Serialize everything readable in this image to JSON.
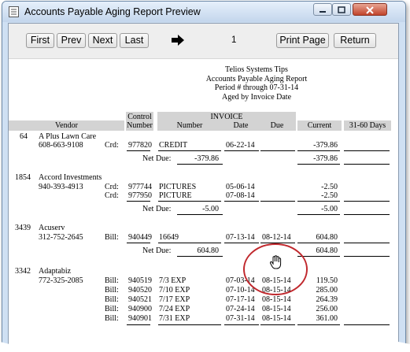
{
  "window": {
    "title": "Accounts Payable Aging Report Preview",
    "accent": "#cfe0f3",
    "close_color": "#c1432b"
  },
  "toolbar": {
    "first": "First",
    "prev": "Prev",
    "next": "Next",
    "last": "Last",
    "page_number": "1",
    "print_page": "Print Page",
    "return": "Return",
    "arrow_icon": "right-arrow-icon"
  },
  "report": {
    "company": "Telios Systems Tips",
    "title": "Accounts Payable Aging Report",
    "period": "Period # through 07-31-14",
    "aged_by": "Aged by Invoice Date",
    "headers": {
      "control_top": "Control",
      "control_bottom": "Number",
      "invoice": "INVOICE",
      "vendor": "Vendor",
      "number": "Number",
      "date": "Date",
      "due": "Due",
      "current": "Current",
      "days_31_60": "31-60 Days"
    },
    "vendors": [
      {
        "id": "64",
        "name": "A Plus Lawn Care",
        "phone": "608-663-9108",
        "lines": [
          {
            "type": "Crd:",
            "control": "977820",
            "number": "CREDIT",
            "date": "06-22-14",
            "due": "",
            "current": "-379.86"
          }
        ],
        "net_label": "Net Due:",
        "net_amount": "-379.86",
        "net_current": "-379.86"
      },
      {
        "id": "1854",
        "name": "Accord Investments",
        "phone": "940-393-4913",
        "lines": [
          {
            "type": "Crd:",
            "control": "977744",
            "number": "PICTURES",
            "date": "05-06-14",
            "due": "",
            "current": "-2.50"
          },
          {
            "type": "Crd:",
            "control": "977950",
            "number": "PICTURE",
            "date": "07-08-14",
            "due": "",
            "current": "-2.50"
          }
        ],
        "net_label": "Net Due:",
        "net_amount": "-5.00",
        "net_current": "-5.00"
      },
      {
        "id": "3439",
        "name": "Acuserv",
        "phone": "312-752-2645",
        "lines": [
          {
            "type": "Bill:",
            "control": "940449",
            "number": "16649",
            "date": "07-13-14",
            "due": "08-12-14",
            "current": "604.80"
          }
        ],
        "net_label": "Net Due:",
        "net_amount": "604.80",
        "net_current": "604.80"
      },
      {
        "id": "3342",
        "name": "Adaptabiz",
        "phone": "772-325-2085",
        "lines": [
          {
            "type": "Bill:",
            "control": "940519",
            "number": "7/3 EXP",
            "date": "07-03-14",
            "due": "08-15-14",
            "current": "119.50"
          },
          {
            "type": "Bill:",
            "control": "940520",
            "number": "7/10 EXP",
            "date": "07-10-14",
            "due": "08-15-14",
            "current": "285.00"
          },
          {
            "type": "Bill:",
            "control": "940521",
            "number": "7/17 EXP",
            "date": "07-17-14",
            "due": "08-15-14",
            "current": "264.39"
          },
          {
            "type": "Bill:",
            "control": "940900",
            "number": "7/24 EXP",
            "date": "07-24-14",
            "due": "08-15-14",
            "current": "256.00"
          },
          {
            "type": "Bill:",
            "control": "940901",
            "number": "7/31 EXP",
            "date": "07-31-14",
            "due": "08-15-14",
            "current": "361.00"
          }
        ]
      }
    ]
  },
  "overlay": {
    "cursor_icon": "hand-cursor-icon",
    "circle_color": "#c0282d"
  }
}
